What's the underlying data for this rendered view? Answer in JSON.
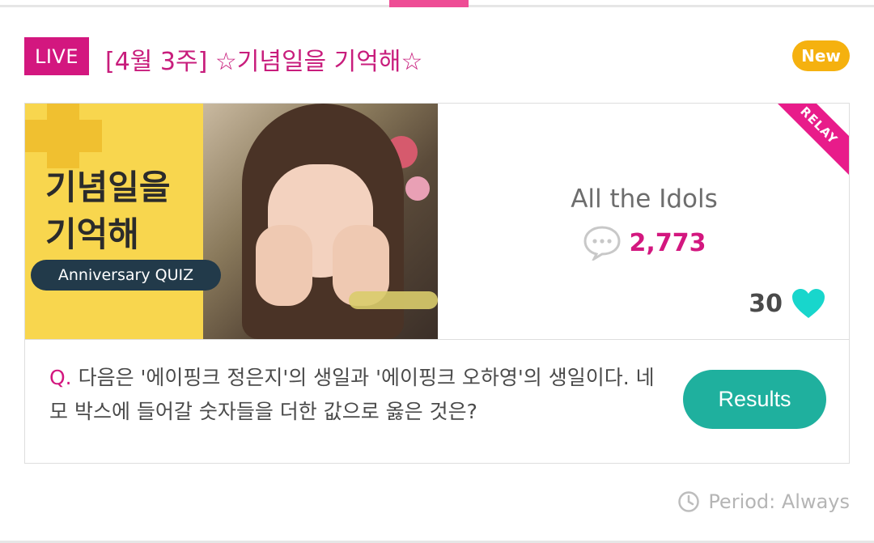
{
  "live_label": "LIVE",
  "title": "[4월 3주] ☆기념일을 기억해☆",
  "new_label": "New",
  "card": {
    "thumbnail": {
      "title_line1": "기념일을",
      "title_line2": "기억해",
      "pill": "Anniversary QUIZ"
    },
    "relay_label": "RELAY",
    "group_name": "All the Idols",
    "comment_count": "2,773",
    "like_count": "30",
    "question_prefix": "Q.",
    "question_text": "다음은 '에이핑크 정은지'의 생일과 '에이핑크 오하영'의 생일이다. 네모 박스에 들어갈 숫자들을 더한 값으로 옳은 것은?",
    "results_label": "Results"
  },
  "period_text": "Period: Always",
  "colors": {
    "brand_pink": "#d3177f",
    "new_yellow": "#f5b10f",
    "teal": "#1fb09e",
    "heart": "#18d6cc"
  },
  "icons": [
    "comment-icon",
    "heart-icon",
    "clock-icon"
  ]
}
